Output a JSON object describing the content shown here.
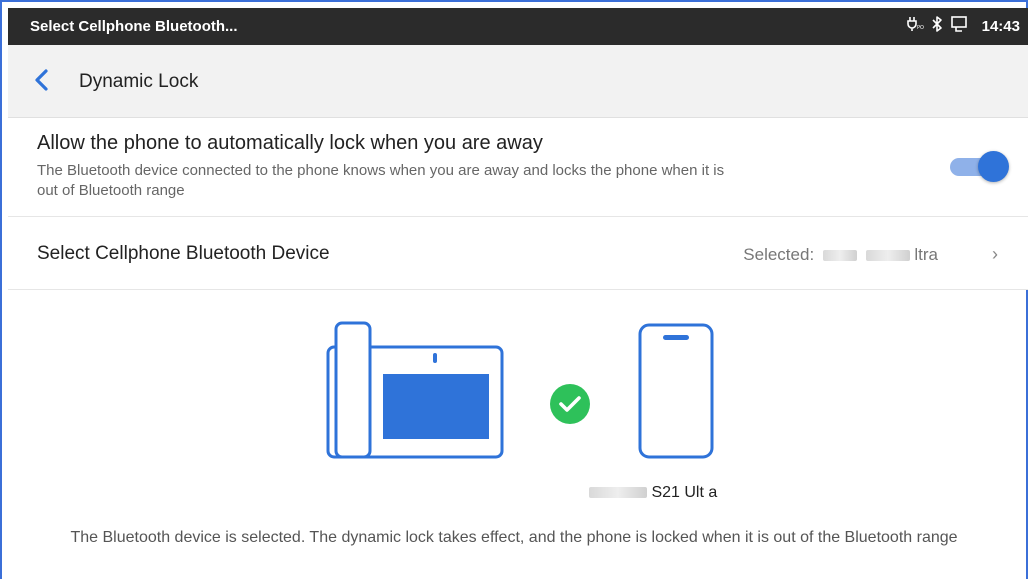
{
  "statusbar": {
    "title": "Select Cellphone Bluetooth...",
    "time": "14:43",
    "icons": [
      "usb-power-icon",
      "bluetooth-icon",
      "screen-cast-icon"
    ]
  },
  "titlebar": {
    "back_icon": "chevron-left-icon",
    "title": "Dynamic Lock"
  },
  "lock_setting": {
    "title": "Allow the phone to automatically lock when you are away",
    "description": "The Bluetooth device connected to the phone knows when you are away and locks the phone when it is out of Bluetooth range",
    "enabled": true
  },
  "device_select": {
    "label": "Select Cellphone Bluetooth Device",
    "selected_prefix": "Selected:",
    "selected_visible_suffix": "ltra",
    "chevron": "›"
  },
  "illustration": {
    "desk_phone_icon": "desk-phone-icon",
    "status_icon": "check-circle-icon",
    "cellphone_icon": "cellphone-icon",
    "phone_name_visible": "S21 Ult a"
  },
  "note": "The Bluetooth device is selected. The dynamic lock takes effect, and the phone is locked when it is out of the Bluetooth range",
  "colors": {
    "accent": "#2f73d9",
    "success": "#2ec15a",
    "statusbar": "#2b2b2b"
  }
}
